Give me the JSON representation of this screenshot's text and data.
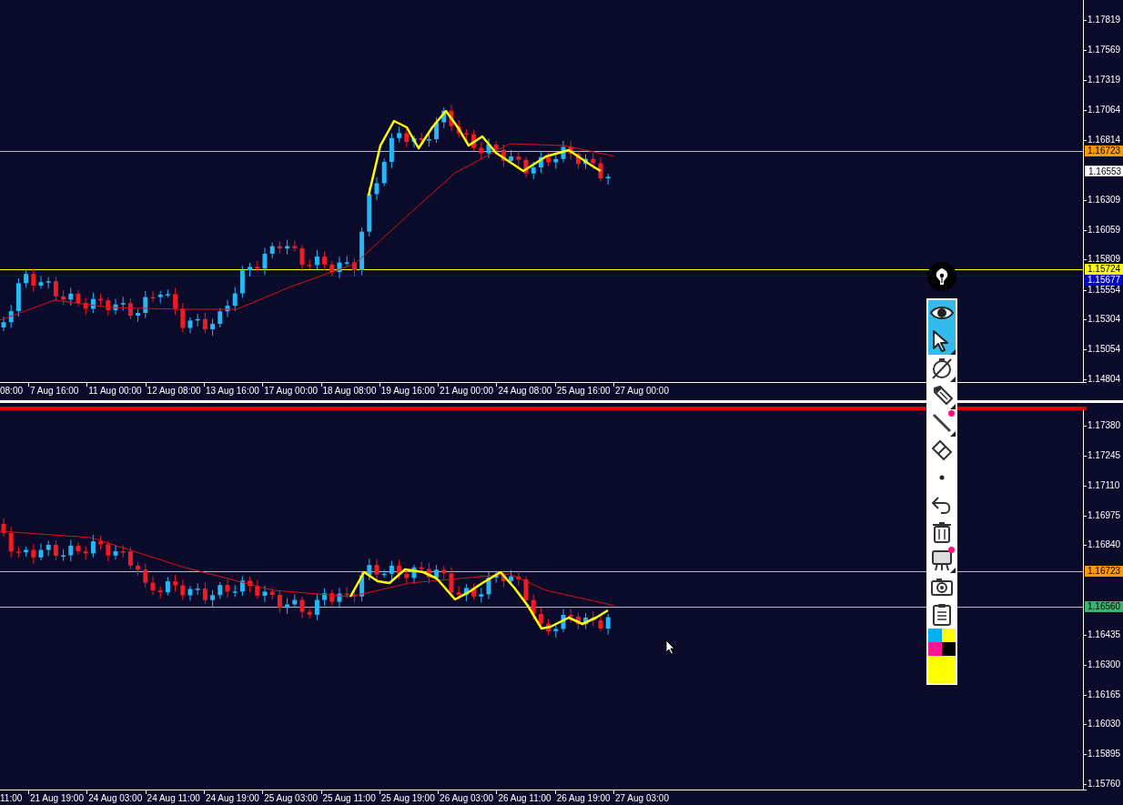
{
  "top_chart": {
    "price_axis": [
      "1.17819",
      "1.17569",
      "1.17319",
      "1.17064",
      "1.16814",
      "1.16309",
      "1.16059",
      "1.15809",
      "1.15554",
      "1.15304",
      "1.15054",
      "1.14804"
    ],
    "price_tags": [
      {
        "text": "1.16723",
        "color": "#ff9900",
        "kind": "price"
      },
      {
        "text": "1.16553",
        "color": "#ffffff",
        "kind": "plain"
      },
      {
        "text": "1.15724",
        "color": "#ffff00",
        "kind": "level"
      },
      {
        "text": "1.15677",
        "color": "#0000cc",
        "kind": "level"
      }
    ],
    "time_axis": [
      "08:00",
      "7 Aug 16:00",
      "11 Aug 00:00",
      "12 Aug 08:00",
      "13 Aug 16:00",
      "17 Aug 00:00",
      "18 Aug 08:00",
      "19 Aug 16:00",
      "21 Aug 00:00",
      "24 Aug 08:00",
      "25 Aug 16:00",
      "27 Aug 00:00"
    ]
  },
  "bottom_chart": {
    "price_axis": [
      "1.17380",
      "1.17245",
      "1.17110",
      "1.16975",
      "1.16840",
      "1.16435",
      "1.16300",
      "1.16165",
      "1.16030",
      "1.15895",
      "1.15760"
    ],
    "price_tags": [
      {
        "text": "1.16723",
        "color": "#ff9900",
        "kind": "price"
      },
      {
        "text": "1.16560",
        "color": "#3cb371",
        "kind": "price"
      }
    ],
    "time_axis": [
      "11:00",
      "21 Aug 19:00",
      "24 Aug 03:00",
      "24 Aug 11:00",
      "24 Aug 19:00",
      "25 Aug 03:00",
      "25 Aug 11:00",
      "25 Aug 19:00",
      "26 Aug 03:00",
      "26 Aug 11:00",
      "26 Aug 19:00",
      "27 Aug 03:00"
    ]
  },
  "toolbar": {
    "tools": [
      {
        "kind": "eye",
        "selected": true,
        "submenu": false,
        "badge": false
      },
      {
        "kind": "arrow",
        "selected": true,
        "submenu": true,
        "badge": false
      },
      {
        "kind": "timer",
        "selected": false,
        "submenu": true,
        "badge": false
      },
      {
        "kind": "pencil",
        "selected": false,
        "submenu": true,
        "badge": false
      },
      {
        "kind": "line",
        "selected": false,
        "submenu": true,
        "badge": true
      },
      {
        "kind": "eraser",
        "selected": false,
        "submenu": false,
        "badge": false
      },
      {
        "kind": "dot",
        "selected": false,
        "submenu": false,
        "badge": false
      },
      {
        "kind": "undo",
        "selected": false,
        "submenu": false,
        "badge": false
      },
      {
        "kind": "trash",
        "selected": false,
        "submenu": false,
        "badge": false
      },
      {
        "kind": "easel",
        "selected": false,
        "submenu": true,
        "badge": true
      },
      {
        "kind": "camera",
        "selected": false,
        "submenu": false,
        "badge": false
      },
      {
        "kind": "clipboard",
        "selected": false,
        "submenu": false,
        "badge": false
      }
    ],
    "palette": [
      {
        "color": "#00b0f0"
      },
      {
        "color": "#ffff00"
      },
      {
        "color": "#ff1493"
      },
      {
        "color": "#000000"
      },
      {
        "color": "#ffff00"
      }
    ]
  }
}
